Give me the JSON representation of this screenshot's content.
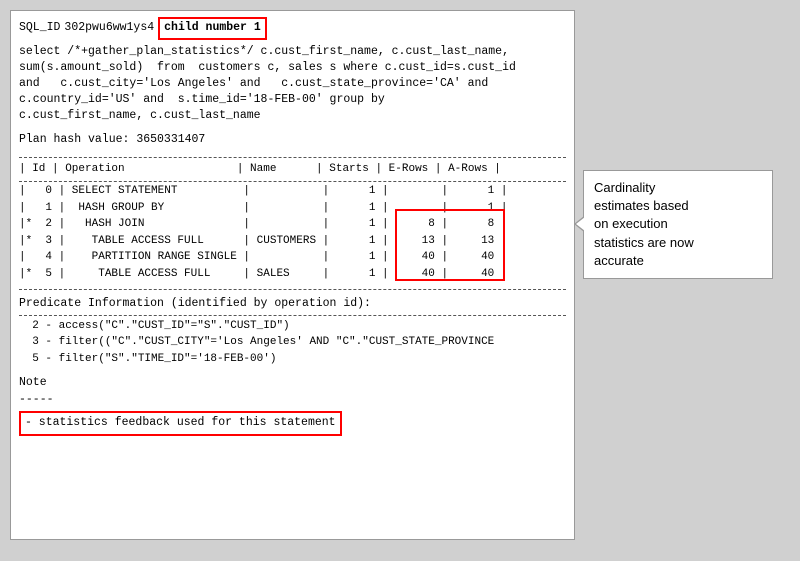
{
  "sqlId": {
    "label": "SQL_ID",
    "value": "302pwu6ww1ys4",
    "childLabel": "child number 1"
  },
  "query": "select /*+gather_plan_statistics*/ c.cust_first_name, c.cust_last_name,\nsum(s.amount_sold)  from  customers c, sales s where c.cust_id=s.cust_id\nand   c.cust_city='Los Angeles' and   c.cust_state_province='CA' and\nc.country_id='US' and  s.time_id='18-FEB-00' group by\nc.cust_first_name, c.cust_last_name",
  "planHash": "Plan hash value: 3650331407",
  "separator1": "--------------------------------------------------------",
  "tableHeader": "| Id | Operation                 | Name      | Starts | E-Rows | A-Rows |",
  "separator2": "--------------------------------------------------------",
  "tableRows": [
    "|   0 | SELECT STATEMENT          |           |      1 |        |      1 |",
    "|   1 |  HASH GROUP BY            |           |      1 |        |      1 |",
    "|*  2 |   HASH JOIN               |           |      1 |      8 |      8 |",
    "|*  3 |    TABLE ACCESS FULL      | CUSTOMERS |      1 |     13 |     13 |",
    "|   4 |    PARTITION RANGE SINGLE |           |      1 |     40 |     40 |",
    "|*  5 |     TABLE ACCESS FULL     | SALES     |      1 |     40 |     40 |"
  ],
  "separator3": "--------------------------------------------------------",
  "predicateTitle": "Predicate Information (identified by operation id):",
  "separator4": "--------------------------------------------------------",
  "predicates": [
    "  2 - access(\"C\".\"CUST_ID\"=\"S\".\"CUST_ID\")",
    "  3 - filter((\"C\".\"CUST_CITY\"='Los Angeles' AND \"C\".\"CUST_STATE_PROVINCE",
    "  5 - filter(\"S\".\"TIME_ID\"='18-FEB-00')"
  ],
  "noteTitle": "Note",
  "noteSeparator": "-----",
  "noteText": "- statistics feedback used for this statement",
  "callout": {
    "line1": "Cardinality",
    "line2": "estimates based",
    "line3": "on execution",
    "line4": "statistics are now",
    "line5": "accurate"
  }
}
